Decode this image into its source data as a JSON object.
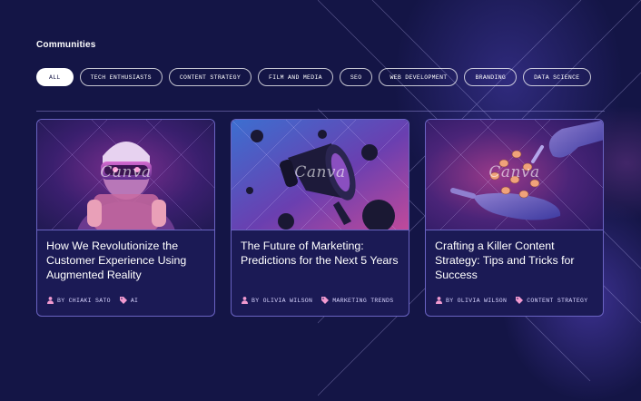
{
  "page": {
    "title": "Communities"
  },
  "filters": [
    {
      "label": "ALL",
      "active": true
    },
    {
      "label": "TECH ENTHUSIASTS",
      "active": false
    },
    {
      "label": "CONTENT STRATEGY",
      "active": false
    },
    {
      "label": "FILM AND MEDIA",
      "active": false
    },
    {
      "label": "SEO",
      "active": false
    },
    {
      "label": "WEB DEVELOPMENT",
      "active": false
    },
    {
      "label": "BRANDING",
      "active": false
    },
    {
      "label": "DATA SCIENCE",
      "active": false
    }
  ],
  "cards": [
    {
      "title": "How We Revolutionize the Customer Experience Using Augmented Reality",
      "author": "BY CHIAKI SATO",
      "tag": "AI",
      "image_watermark": "Canva",
      "image_icon": "vr-headset-icon"
    },
    {
      "title": "The Future of Marketing: Predictions for the Next 5 Years",
      "author": "BY OLIVIA WILSON",
      "tag": "MARKETING TRENDS",
      "image_watermark": "Canva",
      "image_icon": "megaphone-icon"
    },
    {
      "title": "Crafting a Killer Content Strategy: Tips and Tricks for Success",
      "author": "BY OLIVIA WILSON",
      "tag": "CONTENT STRATEGY",
      "image_watermark": "Canva",
      "image_icon": "coins-hands-icon"
    }
  ],
  "colors": {
    "background": "#141546",
    "card_background": "#1b1a55",
    "card_border": "#6a63c2",
    "icon_accent": "#f29ad0"
  }
}
